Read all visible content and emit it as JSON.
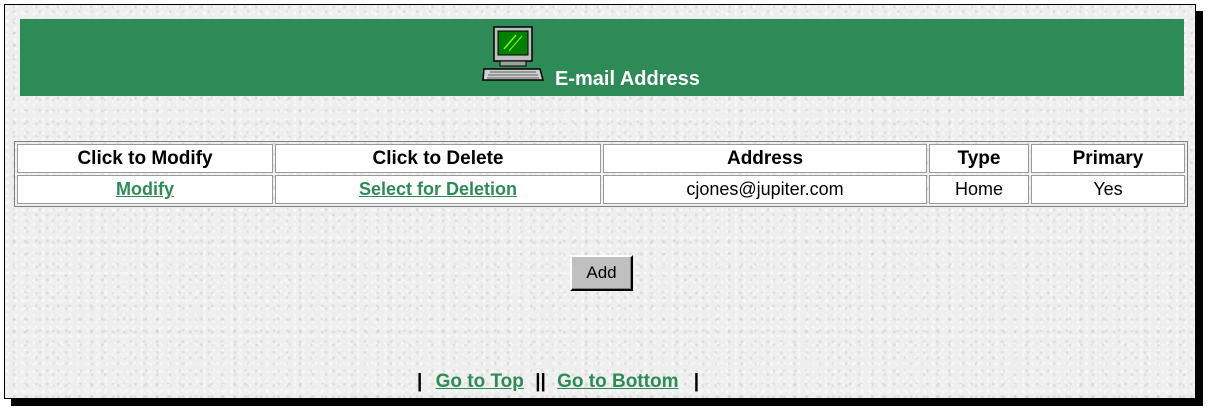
{
  "header": {
    "title": "E-mail Address",
    "icon": "computer-icon",
    "bar_color": "#2e8b57"
  },
  "table": {
    "columns": [
      "Click to Modify",
      "Click to Delete",
      "Address",
      "Type",
      "Primary"
    ],
    "rows": [
      {
        "modify_link": "Modify",
        "delete_link": "Select for Deletion",
        "address": "cjones@jupiter.com",
        "type": "Home",
        "primary": "Yes"
      }
    ]
  },
  "actions": {
    "add_label": "Add"
  },
  "footer": {
    "separator_left": "|",
    "go_to_top": "Go to Top",
    "separator_mid": "||",
    "go_to_bottom": "Go to Bottom",
    "separator_right": "|"
  },
  "colors": {
    "link": "#2e8b57",
    "header_text": "#ffffff"
  }
}
